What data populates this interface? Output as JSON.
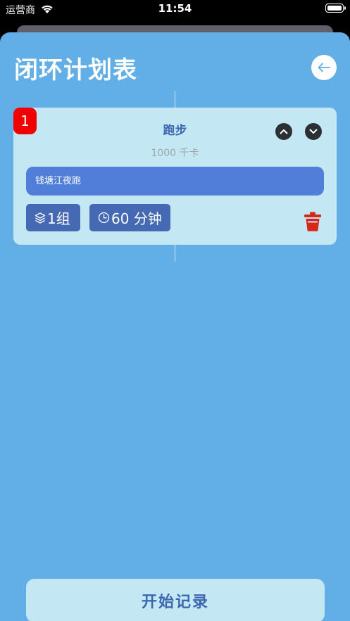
{
  "status_bar": {
    "carrier": "运营商",
    "time": "11:54"
  },
  "header": {
    "title": "闭环计划表",
    "back_icon": "arrow-left-icon"
  },
  "plan_items": [
    {
      "index": "1",
      "name": "跑步",
      "calories": "1000 千卡",
      "note": "钱塘江夜跑",
      "sets": "1组",
      "duration": "60 分钟"
    }
  ],
  "footer": {
    "start_label": "开始记录"
  },
  "colors": {
    "sheet_bg": "#62aee6",
    "card_bg": "#c3e8f3",
    "accent_text": "#3c67b0",
    "note_bg": "#507ed9",
    "chip_bg": "#4669b4",
    "badge_red": "#f00000",
    "delete_red": "#d8261a"
  }
}
